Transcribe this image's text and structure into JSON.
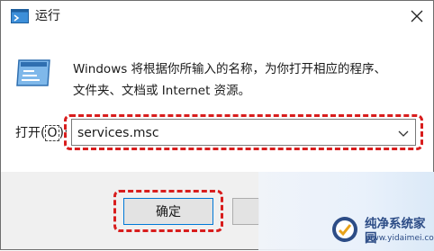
{
  "window": {
    "title": "运行",
    "close_icon": "close-icon"
  },
  "description": {
    "line1": "Windows 将根据你所输入的名称，为你打开相应的程序、",
    "line2": "文件夹、文档或 Internet 资源。"
  },
  "open_field": {
    "label_prefix": "打开(",
    "label_accel": "O",
    "label_suffix": "):",
    "value": "services.msc"
  },
  "buttons": {
    "ok_label": "确定"
  },
  "watermark": {
    "title": "纯净系统家园",
    "url": "www.yidaimei.com"
  },
  "colors": {
    "highlight_border": "#d81d1d",
    "focus_border": "#0078d7",
    "footer_bg": "#f0f0f0",
    "watermark_text": "#2c4c86"
  }
}
